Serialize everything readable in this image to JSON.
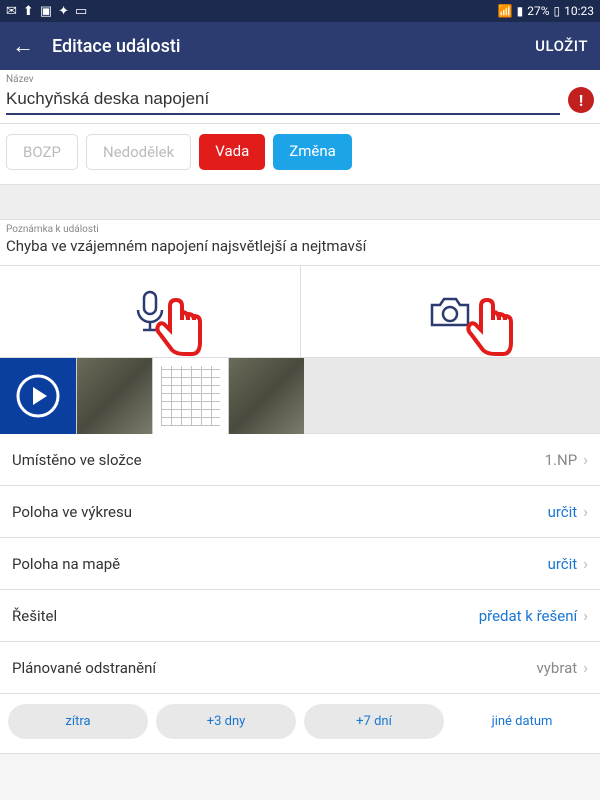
{
  "status": {
    "battery_pct": "27%",
    "time": "10:23"
  },
  "appbar": {
    "title": "Editace události",
    "save": "ULOŽIT"
  },
  "name": {
    "label": "Název",
    "value": "Kuchyňská deska napojení"
  },
  "tags": {
    "bozp": "BOZP",
    "nedodelek": "Nedodělek",
    "vada": "Vada",
    "zmena": "Změna"
  },
  "note": {
    "label": "Poznámka k události",
    "text": "Chyba ve vzájemném napojení najsvětlejší a nejtmavší"
  },
  "rows": {
    "folder": {
      "label": "Umístěno ve složce",
      "value": "1.NP"
    },
    "drawing": {
      "label": "Poloha ve výkresu",
      "value": "určit"
    },
    "map": {
      "label": "Poloha na mapě",
      "value": "určit"
    },
    "solver": {
      "label": "Řešitel",
      "value": "předat k řešení"
    },
    "planned": {
      "label": "Plánované odstranění",
      "value": "vybrat"
    }
  },
  "date_buttons": {
    "tomorrow": "zítra",
    "plus3": "+3 dny",
    "plus7": "+7 dní",
    "other": "jiné datum"
  }
}
